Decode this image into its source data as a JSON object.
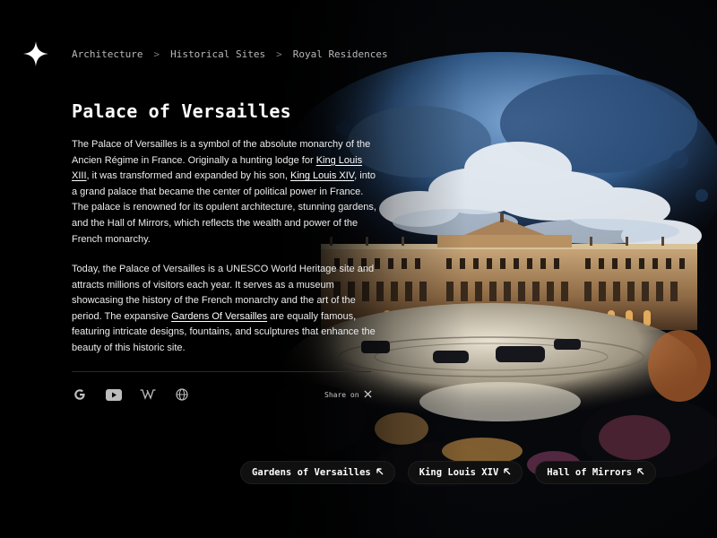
{
  "breadcrumb": {
    "items": [
      "Architecture",
      "Historical Sites",
      "Royal Residences"
    ],
    "separator": ">"
  },
  "article": {
    "title": "Palace of Versailles",
    "p1": {
      "t1": "The Palace of Versailles is a symbol of the absolute monarchy of the Ancien Régime in France. Originally a hunting lodge for ",
      "link1": "King Louis XIII",
      "t2": ", it was transformed and expanded by his son, ",
      "link2": "King Louis XIV",
      "t3": ", into a grand palace that became the center of political power in France. The palace is renowned for its opulent architecture, stunning gardens, and the Hall of Mirrors, which reflects the wealth and power of the French monarchy."
    },
    "p2": {
      "t1": "Today, the Palace of Versailles is a UNESCO World Heritage site and attracts millions of visitors each year. It serves as a museum showcasing the history of the French monarchy and the art of the period. The expansive ",
      "link1": "Gardens Of Versailles",
      "t2": " are equally famous, featuring intricate designs, fountains, and sculptures that enhance the beauty of this historic site."
    }
  },
  "socials": [
    {
      "icon": "google-icon"
    },
    {
      "icon": "youtube-icon"
    },
    {
      "icon": "wikipedia-icon"
    },
    {
      "icon": "globe-icon"
    }
  ],
  "share": {
    "label": "Share on",
    "icon": "x-icon"
  },
  "tags": [
    {
      "label": "Gardens of Versailles",
      "icon": "arrow-up-left-icon"
    },
    {
      "label": "King Louis XIV",
      "icon": "arrow-up-left-icon"
    },
    {
      "label": "Hall of Mirrors",
      "icon": "arrow-up-left-icon"
    }
  ],
  "colors": {
    "background": "#000000",
    "text": "#f2f2f2",
    "tag_bg": "#101010",
    "muted": "#b8b8b8"
  }
}
